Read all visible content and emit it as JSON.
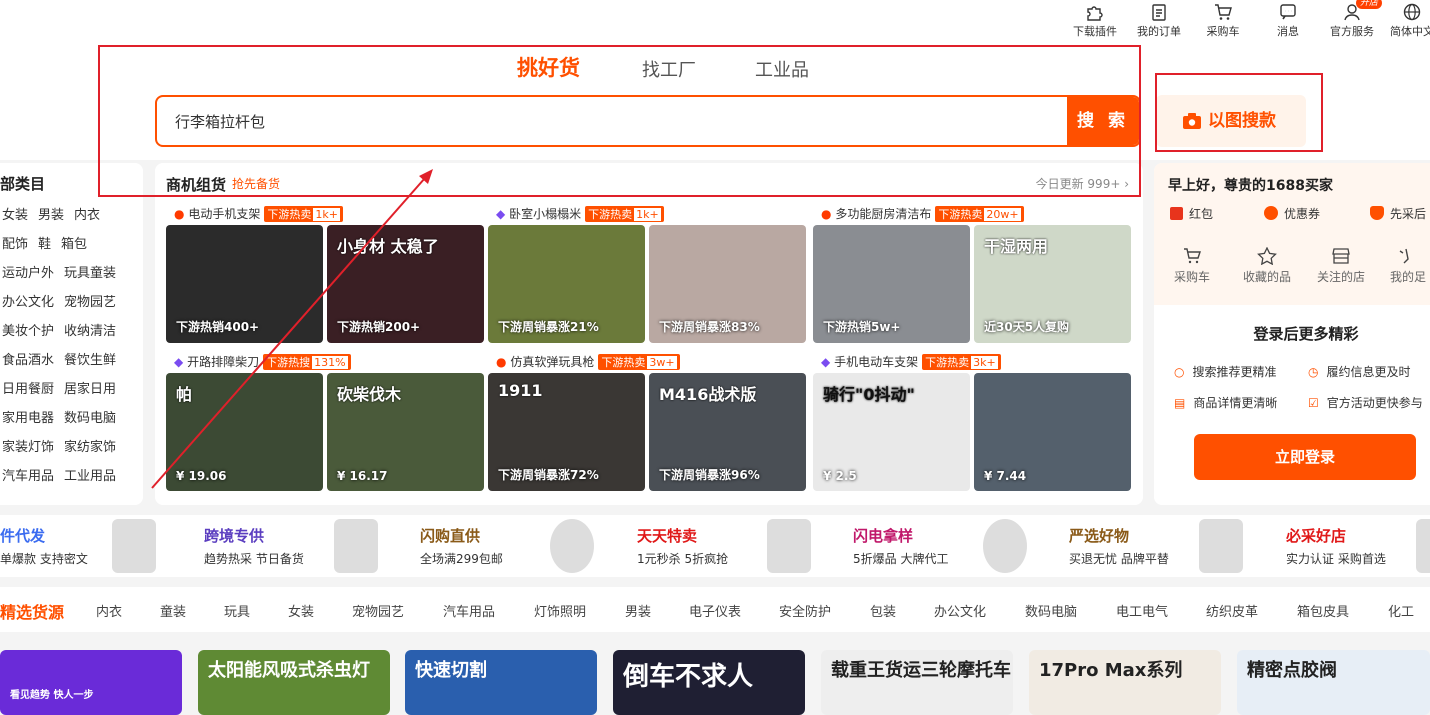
{
  "topnav": [
    {
      "label": "下载插件",
      "icon": "puzzle-icon"
    },
    {
      "label": "我的订单",
      "icon": "clipboard-icon"
    },
    {
      "label": "采购车",
      "icon": "cart-icon"
    },
    {
      "label": "消息",
      "icon": "message-icon"
    },
    {
      "label": "官方服务",
      "icon": "user-service-icon",
      "badge": "开店"
    },
    {
      "label": "简体中文",
      "icon": "globe-icon"
    }
  ],
  "search": {
    "tabs": [
      "挑好货",
      "找工厂",
      "工业品"
    ],
    "value": "行李箱拉杆包",
    "button": "搜 索",
    "image_search": "以图搜款"
  },
  "categories": {
    "title": "部类目",
    "rows": [
      [
        "女装",
        "男装",
        "内衣"
      ],
      [
        "配饰",
        "鞋",
        "箱包"
      ],
      [
        "运动户外",
        "玩具童装"
      ],
      [
        "办公文化",
        "宠物园艺"
      ],
      [
        "美妆个护",
        "收纳清洁"
      ],
      [
        "食品酒水",
        "餐饮生鲜"
      ],
      [
        "日用餐厨",
        "居家日用"
      ],
      [
        "家用电器",
        "数码电脑"
      ],
      [
        "家装灯饰",
        "家纺家饰"
      ],
      [
        "汽车用品",
        "工业用品"
      ]
    ]
  },
  "deals": {
    "title": "商机组货",
    "subtitle": "抢先备货",
    "update": "今日更新 999+ ›",
    "groups": [
      {
        "name": "电动手机支架",
        "tag": "下游热卖",
        "num": "1k+",
        "icon": "flame",
        "tiles": [
          {
            "cap": "下游热销400+",
            "text": "",
            "color": "#2b2b2b"
          },
          {
            "cap": "下游热销200+",
            "text": "小身材 太稳了",
            "color": "#3a1f24"
          }
        ]
      },
      {
        "name": "卧室小榻榻米",
        "tag": "下游热卖",
        "num": "1k+",
        "icon": "badge",
        "tiles": [
          {
            "cap": "下游周销暴涨21%",
            "text": "",
            "color": "#6b7a3a"
          },
          {
            "cap": "下游周销暴涨83%",
            "text": "",
            "color": "#b9a8a2"
          }
        ]
      },
      {
        "name": "多功能厨房清洁布",
        "tag": "下游热卖",
        "num": "20w+",
        "icon": "flame",
        "tiles": [
          {
            "cap": "下游热销5w+",
            "text": "",
            "color": "#8a8d92"
          },
          {
            "cap": "近30天5人复购",
            "text": "干湿两用",
            "color": "#cfd8c8"
          }
        ]
      },
      {
        "name": "开路排障柴刀",
        "tag": "下游热搜",
        "num": "131%",
        "icon": "badge",
        "tiles": [
          {
            "cap": "¥ 19.06",
            "text": "帕",
            "color": "#3c4a34"
          },
          {
            "cap": "¥ 16.17",
            "text": "砍柴伐木",
            "color": "#4a5a3a"
          }
        ]
      },
      {
        "name": "仿真软弹玩具枪",
        "tag": "下游热卖",
        "num": "3w+",
        "icon": "flame",
        "tiles": [
          {
            "cap": "下游周销暴涨72%",
            "text": "1911",
            "color": "#3a3734"
          },
          {
            "cap": "下游周销暴涨96%",
            "text": "M416战术版",
            "color": "#4a4f55"
          }
        ]
      },
      {
        "name": "手机电动车支架",
        "tag": "下游热卖",
        "num": "3k+",
        "icon": "badge",
        "tiles": [
          {
            "cap": "¥ 2.5",
            "text": "骑行\"0抖动\"",
            "color": "#e9e9e9"
          },
          {
            "cap": "¥ 7.44",
            "text": "",
            "color": "#54606c"
          }
        ]
      }
    ]
  },
  "account": {
    "greeting": "早上好，尊贵的1688买家",
    "perks": [
      "红包",
      "优惠券",
      "先采后"
    ],
    "shortcuts": [
      "采购车",
      "收藏的品",
      "关注的店",
      "我的足"
    ],
    "login_title": "登录后更多精彩",
    "benefits": [
      "搜索推荐更精准",
      "履约信息更及时",
      "商品详情更清晰",
      "官方活动更快参与"
    ],
    "login_button": "立即登录"
  },
  "promos": [
    {
      "t1": "件代发",
      "t2": "单爆款 支持密文",
      "color": "#3b6cf0"
    },
    {
      "t1": "跨境专供",
      "t2": "趋势热采 节日备货",
      "color": "#5b3ec0"
    },
    {
      "t1": "闪购直供",
      "t2": "全场满299包邮",
      "color": "#8a5a18"
    },
    {
      "t1": "天天特卖",
      "t2": "1元秒杀 5折疯抢",
      "color": "#e01818"
    },
    {
      "t1": "闪电拿样",
      "t2": "5折爆品 大牌代工",
      "color": "#c0186a"
    },
    {
      "t1": "严选好物",
      "t2": "买退无忧 品牌平替",
      "color": "#8a5a18"
    },
    {
      "t1": "必采好店",
      "t2": "实力认证 采购首选",
      "color": "#e01818"
    }
  ],
  "source_nav": {
    "title": "精选货源",
    "items": [
      "内衣",
      "童装",
      "玩具",
      "女装",
      "宠物园艺",
      "汽车用品",
      "灯饰照明",
      "男装",
      "电子仪表",
      "安全防护",
      "包装",
      "办公文化",
      "数码电脑",
      "电工电气",
      "纺织皮革",
      "箱包皮具",
      "化工"
    ]
  },
  "bottom_tiles": [
    {
      "text": "看见趋势 快人一步",
      "color": "#6a2bd8"
    },
    {
      "text": "太阳能风吸式杀虫灯",
      "color": "#5f8a34"
    },
    {
      "text": "快速切割",
      "color": "#2a5fae"
    },
    {
      "text": "倒车不求人",
      "color": "#1f1f33"
    },
    {
      "text": "载重王货运三轮摩托车",
      "color": "#eeeeee"
    },
    {
      "text": "17Pro Max系列",
      "color": "#f1ebe3"
    },
    {
      "text": "精密点胶阀",
      "color": "#e7eef6"
    }
  ],
  "colors": {
    "brand": "#ff5000",
    "annotation": "#e0202a"
  }
}
